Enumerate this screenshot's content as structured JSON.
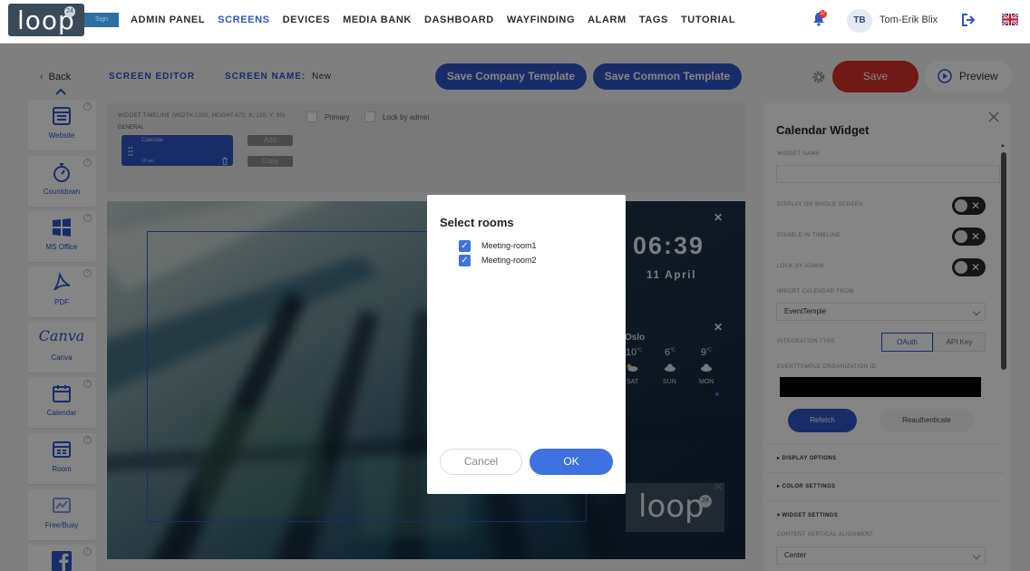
{
  "logo": {
    "text": "loop",
    "badge": "24",
    "chip": "Sign"
  },
  "nav": {
    "items": [
      "ADMIN PANEL",
      "SCREENS",
      "DEVICES",
      "MEDIA BANK",
      "DASHBOARD",
      "WAYFINDING",
      "ALARM",
      "TAGS",
      "TUTORIAL"
    ],
    "active": "SCREENS",
    "notification_count": "17",
    "user_initials": "TB",
    "user_name": "Tom-Erik Blix",
    "language_icon": "uk-flag-icon"
  },
  "subheader": {
    "back_label": "Back",
    "editor_label": "SCREEN EDITOR",
    "screen_name_label": "SCREEN NAME:",
    "screen_name_value": "New",
    "save_company_template": "Save Company Template",
    "save_common_template": "Save Common Template",
    "save_label": "Save",
    "preview_label": "Preview"
  },
  "widgets": [
    {
      "label": "Website",
      "icon": "website-icon"
    },
    {
      "label": "Countdown",
      "icon": "stopwatch-icon"
    },
    {
      "label": "MS Office",
      "icon": "windows-icon"
    },
    {
      "label": "PDF",
      "icon": "pdf-icon"
    },
    {
      "label": "Canva",
      "icon": "canva-icon"
    },
    {
      "label": "Calendar",
      "icon": "calendar-icon"
    },
    {
      "label": "Room",
      "icon": "room-icon"
    },
    {
      "label": "Free/Busy",
      "icon": "free-busy-icon"
    },
    {
      "label": "",
      "icon": "facebook-icon"
    }
  ],
  "timeline": {
    "title": "WIDGET TIMELINE (WIDTH:1320, HEIGHT:870, X: 120, Y: 90)",
    "primary_label": "Primary",
    "lock_label": "Lock by admin",
    "group_label": "GENERAL",
    "block_name": "Calendar",
    "block_duration": "10 sec",
    "add_label": "Add",
    "copy_label": "Copy"
  },
  "canvas": {
    "time": "06:39",
    "date": "11 April",
    "city": "Oslo",
    "forecast": [
      {
        "temp": "10",
        "unit": "°C",
        "day": "SAT"
      },
      {
        "temp": "6",
        "unit": "°C",
        "day": "SUN"
      },
      {
        "temp": "9",
        "unit": "°C",
        "day": "MON"
      }
    ],
    "loop_text": "loop",
    "loop_badge": "24"
  },
  "panel": {
    "title": "Calendar Widget",
    "widget_name_label": "WIDGET NAME",
    "widget_name_value": "",
    "display_whole_label": "DISPLAY ON WHOLE SCREEN",
    "disable_timeline_label": "DISABLE IN TIMELINE",
    "lock_admin_label": "LOCK BY ADMIN",
    "import_label": "IMPORT CALENDAR FROM",
    "import_value": "EventTemple",
    "integration_label": "INTEGRATION TYPE",
    "integration_oauth": "OAuth",
    "integration_apikey": "API Key",
    "org_id_label": "EVENTTEMPLE ORGANIZATION ID",
    "refetch_label": "Refetch",
    "reauth_label": "Reauthenticate",
    "display_options": "DISPLAY OPTIONS",
    "color_settings": "COLOR SETTINGS",
    "widget_settings": "WIDGET SETTINGS",
    "vertical_align_label": "CONTENT VERTICAL ALIGNMENT",
    "vertical_align_value": "Center"
  },
  "modal": {
    "title": "Select rooms",
    "rooms": [
      {
        "label": "Meeting-room1",
        "checked": true
      },
      {
        "label": "Meeting-room2",
        "checked": true
      }
    ],
    "cancel_label": "Cancel",
    "ok_label": "OK"
  },
  "colors": {
    "primary_blue": "#2e57c7",
    "save_red": "#d7312b",
    "checkbox_blue": "#3d72e0"
  }
}
